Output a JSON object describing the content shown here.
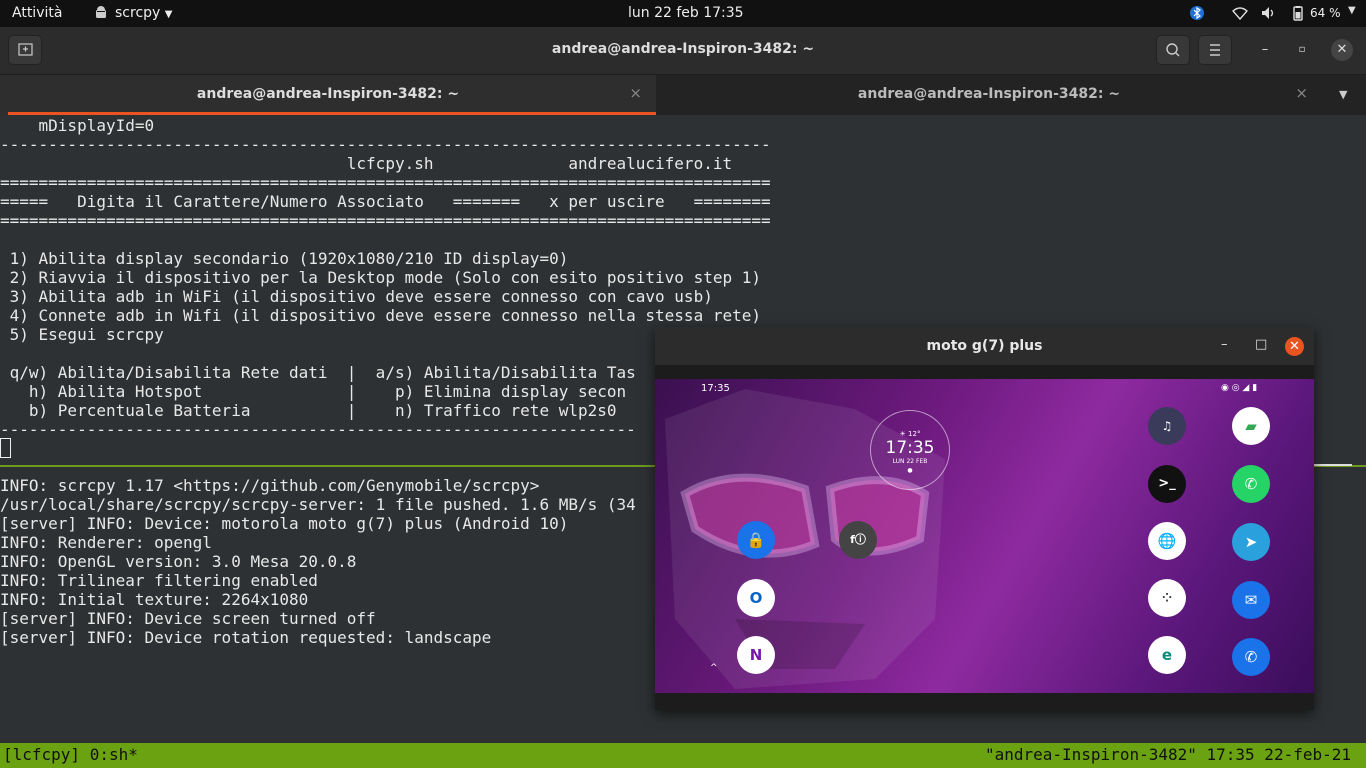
{
  "topbar": {
    "activities": "Attività",
    "app_name": "scrcpy",
    "datetime": "lun 22 feb  17:35",
    "battery": "64 %"
  },
  "window": {
    "title": "andrea@andrea-Inspiron-3482: ~"
  },
  "tabs": [
    {
      "label": "andrea@andrea-Inspiron-3482: ~",
      "close": "×"
    },
    {
      "label": "andrea@andrea-Inspiron-3482: ~",
      "close": "×"
    }
  ],
  "terminal": {
    "lines_top": [
      "    mDisplayId=0",
      "--------------------------------------------------------------------------------",
      "                                    lcfcpy.sh              andrealucifero.it",
      "================================================================================",
      "=====   Digita il Carattere/Numero Associato   =======   x per uscire   ========",
      "================================================================================",
      "",
      " 1) Abilita display secondario (1920x1080/210 ID display=0)",
      " 2) Riavvia il dispositivo per la Desktop mode (Solo con esito positivo step 1)",
      " 3) Abilita adb in WiFi (il dispositivo deve essere connesso con cavo usb)",
      " 4) Connete adb in Wifi (il dispositivo deve essere connesso nella stessa rete)",
      " 5) Esegui scrcpy",
      "",
      " q/w) Abilita/Disabilita Rete dati  |  a/s) Abilita/Disabilita Tas",
      "   h) Abilita Hotspot               |    p) Elimina display secon",
      "   b) Percentuale Batteria          |    n) Traffico rete wlp2s0",
      "------------------------------------------------------------------"
    ],
    "lines_bottom": [
      "INFO: scrcpy 1.17 <https://github.com/Genymobile/scrcpy>",
      "/usr/local/share/scrcpy/scrcpy-server: 1 file pushed. 1.6 MB/s (34",
      "[server] INFO: Device: motorola moto g(7) plus (Android 10)",
      "INFO: Renderer: opengl",
      "INFO: OpenGL version: 3.0 Mesa 20.0.8",
      "INFO: Trilinear filtering enabled",
      "INFO: Initial texture: 2264x1080",
      "[server] INFO: Device screen turned off",
      "[server] INFO: Device rotation requested: landscape"
    ]
  },
  "tmux": {
    "left": "[lcfcpy] 0:sh*",
    "right": "\"andrea-Inspiron-3482\" 17:35 22-feb-21"
  },
  "scrcpy_window": {
    "title": "moto g(7) plus",
    "minimize": "–",
    "maximize": "□",
    "close": "✕"
  },
  "phone": {
    "status_time": "17:35",
    "clock_temp": "☀ 12°",
    "clock_time": "17:35",
    "clock_date": "LUN  22  FEB"
  },
  "colors": {
    "accent": "#e95420",
    "tmux_bar": "#6aa212",
    "terminal_bg": "#2d3133"
  }
}
